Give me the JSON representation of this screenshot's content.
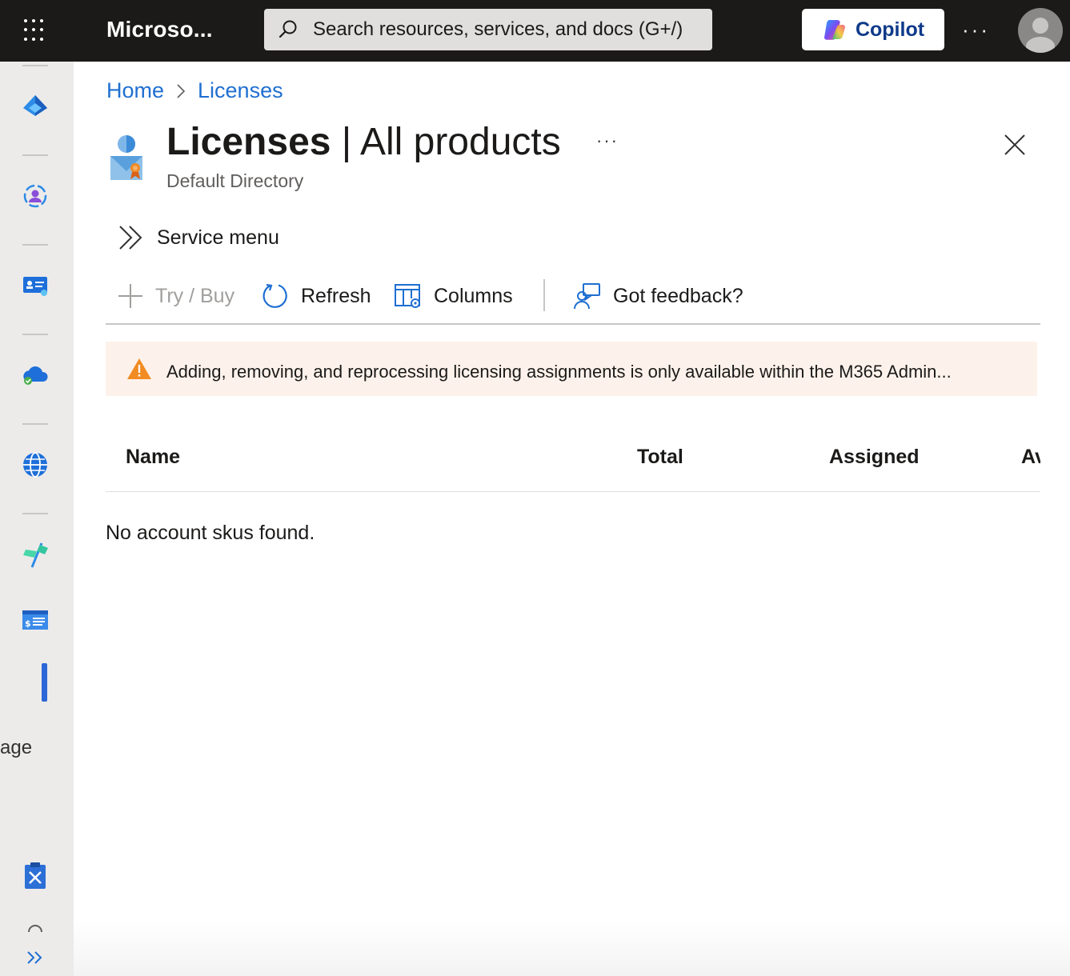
{
  "topbar": {
    "brand": "Microso...",
    "search_placeholder": "Search resources, services, and docs (G+/)",
    "copilot_label": "Copilot",
    "more_label": "···"
  },
  "breadcrumb": {
    "items": [
      "Home",
      "Licenses"
    ]
  },
  "header": {
    "title_bold": "Licenses",
    "title_rest": " | All products",
    "subtitle": "Default Directory",
    "more_label": "···"
  },
  "service_menu": {
    "label": "Service menu"
  },
  "toolbar": {
    "try_buy": "Try / Buy",
    "refresh": "Refresh",
    "columns": "Columns",
    "feedback": "Got feedback?"
  },
  "warning": {
    "message": "Adding, removing, and reprocessing licensing assignments is only available within the M365 Admin..."
  },
  "table": {
    "columns": [
      "Name",
      "Total",
      "Assigned",
      "Av"
    ],
    "empty_message": "No account skus found."
  },
  "left_rail": {
    "cut_label": "age",
    "icons": [
      "entra-id-icon",
      "users-groups-icon",
      "identity-card-icon",
      "cloud-sync-icon",
      "globe-icon",
      "flag-icon",
      "billing-icon",
      "clipboard-tools-icon",
      "expand-chevron-icon"
    ]
  },
  "colors": {
    "topbar": "#1b1a19",
    "link": "#1f6fd1",
    "warning_bg": "#fdf2eb",
    "warning_icon": "#f28b22",
    "rail_bg": "#ecebea"
  }
}
